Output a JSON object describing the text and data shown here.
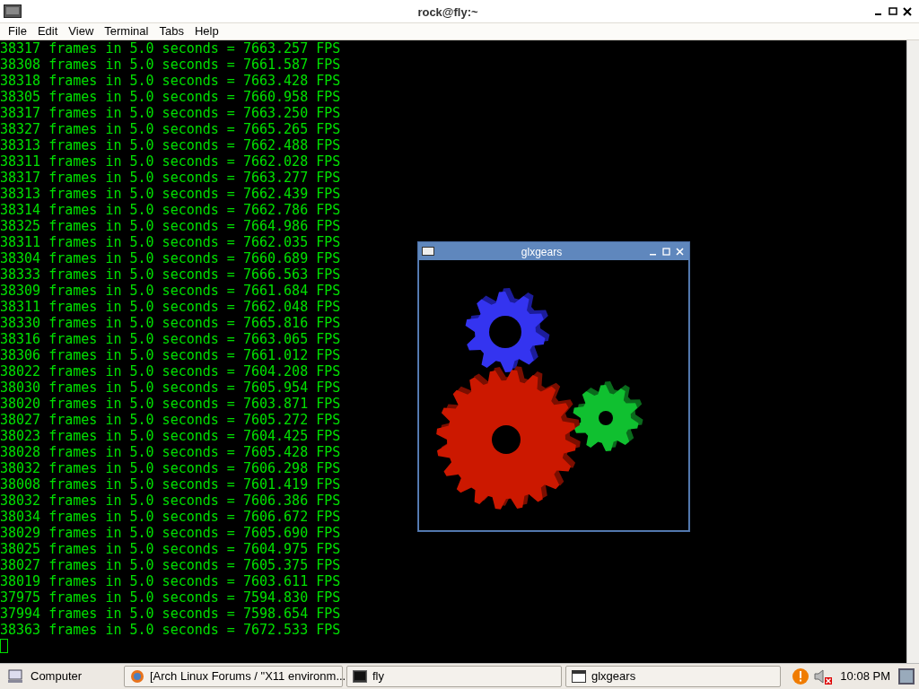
{
  "terminal_window": {
    "title": "rock@fly:~",
    "menu": [
      "File",
      "Edit",
      "View",
      "Terminal",
      "Tabs",
      "Help"
    ],
    "lines": [
      "38317 frames in 5.0 seconds = 7663.257 FPS",
      "38308 frames in 5.0 seconds = 7661.587 FPS",
      "38318 frames in 5.0 seconds = 7663.428 FPS",
      "38305 frames in 5.0 seconds = 7660.958 FPS",
      "38317 frames in 5.0 seconds = 7663.250 FPS",
      "38327 frames in 5.0 seconds = 7665.265 FPS",
      "38313 frames in 5.0 seconds = 7662.488 FPS",
      "38311 frames in 5.0 seconds = 7662.028 FPS",
      "38317 frames in 5.0 seconds = 7663.277 FPS",
      "38313 frames in 5.0 seconds = 7662.439 FPS",
      "38314 frames in 5.0 seconds = 7662.786 FPS",
      "38325 frames in 5.0 seconds = 7664.986 FPS",
      "38311 frames in 5.0 seconds = 7662.035 FPS",
      "38304 frames in 5.0 seconds = 7660.689 FPS",
      "38333 frames in 5.0 seconds = 7666.563 FPS",
      "38309 frames in 5.0 seconds = 7661.684 FPS",
      "38311 frames in 5.0 seconds = 7662.048 FPS",
      "38330 frames in 5.0 seconds = 7665.816 FPS",
      "38316 frames in 5.0 seconds = 7663.065 FPS",
      "38306 frames in 5.0 seconds = 7661.012 FPS",
      "38022 frames in 5.0 seconds = 7604.208 FPS",
      "38030 frames in 5.0 seconds = 7605.954 FPS",
      "38020 frames in 5.0 seconds = 7603.871 FPS",
      "38027 frames in 5.0 seconds = 7605.272 FPS",
      "38023 frames in 5.0 seconds = 7604.425 FPS",
      "38028 frames in 5.0 seconds = 7605.428 FPS",
      "38032 frames in 5.0 seconds = 7606.298 FPS",
      "38008 frames in 5.0 seconds = 7601.419 FPS",
      "38032 frames in 5.0 seconds = 7606.386 FPS",
      "38034 frames in 5.0 seconds = 7606.672 FPS",
      "38029 frames in 5.0 seconds = 7605.690 FPS",
      "38025 frames in 5.0 seconds = 7604.975 FPS",
      "38027 frames in 5.0 seconds = 7605.375 FPS",
      "38019 frames in 5.0 seconds = 7603.611 FPS",
      "37975 frames in 5.0 seconds = 7594.830 FPS",
      "37994 frames in 5.0 seconds = 7598.654 FPS",
      "38363 frames in 5.0 seconds = 7672.533 FPS"
    ]
  },
  "gears_window": {
    "title": "glxgears"
  },
  "taskbar": {
    "menu_label": "Computer",
    "tasks": [
      {
        "kind": "browser",
        "label": "[Arch Linux Forums / \"X11 environm..."
      },
      {
        "kind": "terminal",
        "label": "fly"
      },
      {
        "kind": "window",
        "label": "glxgears"
      }
    ],
    "clock": "10:08 PM"
  }
}
